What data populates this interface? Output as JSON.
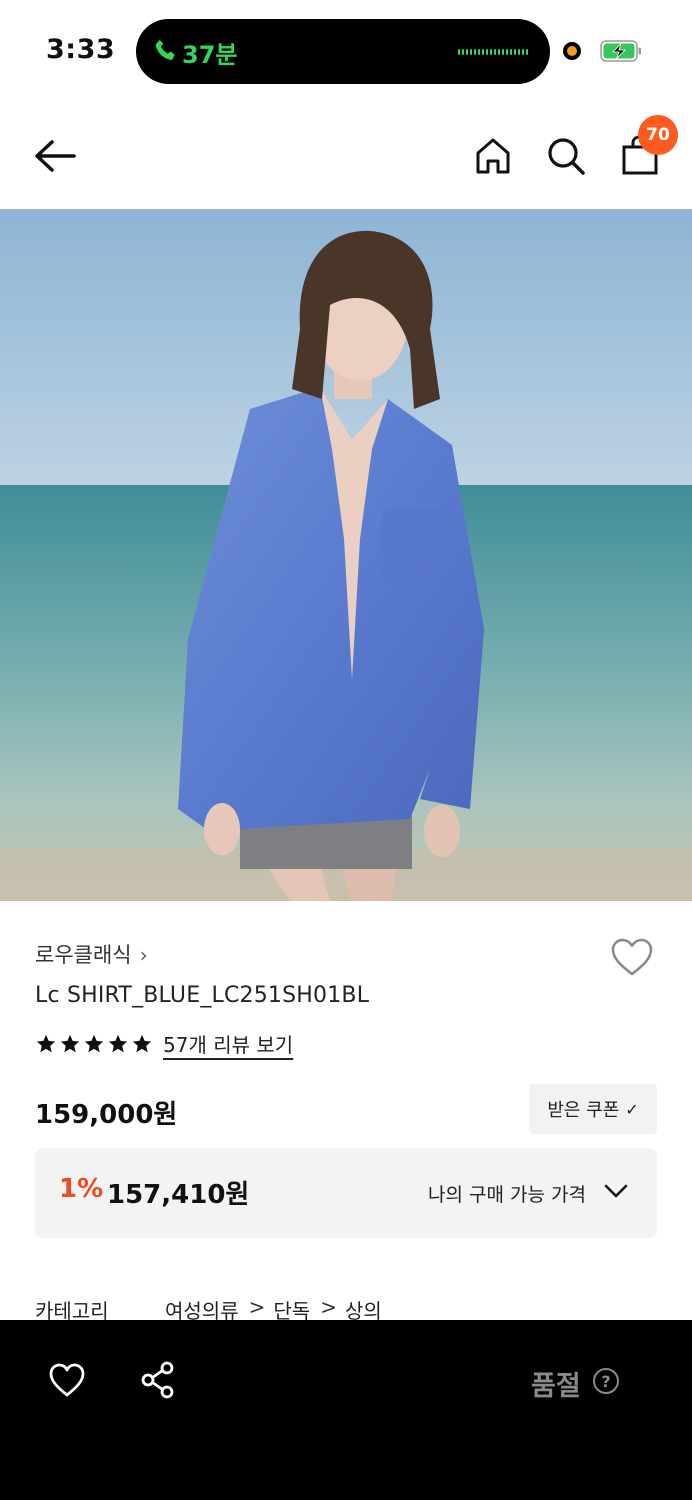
{
  "status_bar": {
    "time": "3:33",
    "call_duration": "37분"
  },
  "header": {
    "cart_count": "70"
  },
  "product": {
    "brand": "로우클래식",
    "brand_chevron": "›",
    "name": "Lc SHIRT_BLUE_LC251SH01BL",
    "rating_stars": 5,
    "review_link": "57개 리뷰 보기",
    "price": "159,000원",
    "coupon_button": "받은 쿠폰",
    "coupon_check": "✓",
    "my_price": {
      "discount": "1%",
      "amount": "157,410원",
      "label": "나의 구매 가능 가격"
    },
    "category": {
      "label": "카테고리",
      "path": [
        "여성의류",
        "단독",
        "상의"
      ],
      "separator": ">"
    }
  },
  "bottom_bar": {
    "status": "품절",
    "help_symbol": "?"
  },
  "icons": {
    "back": "arrow-left-icon",
    "home": "home-icon",
    "search": "search-icon",
    "cart": "shopping-bag-icon",
    "wish": "heart-icon",
    "share": "share-icon",
    "help": "question-circle-icon"
  },
  "colors": {
    "accent": "#ff5a1f",
    "discount": "#ef4a23",
    "bottom_bar": "#000000",
    "soldout_text": "#8a8a8a"
  }
}
